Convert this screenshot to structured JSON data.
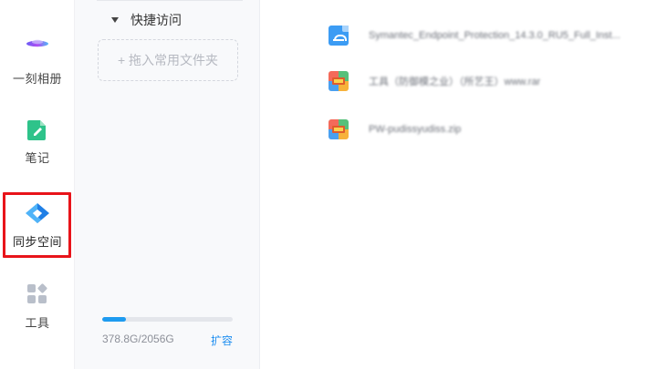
{
  "sidebar": {
    "items": [
      {
        "id": "album",
        "label": "一刻相册",
        "icon": "cloud-photo-icon"
      },
      {
        "id": "notes",
        "label": "笔记",
        "icon": "note-pencil-icon"
      },
      {
        "id": "sync",
        "label": "同步空间",
        "icon": "sync-space-icon",
        "active": true
      },
      {
        "id": "tools",
        "label": "工具",
        "icon": "apps-grid-icon"
      }
    ]
  },
  "quick_access": {
    "title": "快捷访问",
    "drop_hint": "+ 拖入常用文件夹"
  },
  "storage": {
    "usage_text": "378.8G/2056G",
    "used_fraction": 0.184,
    "expand_label": "扩容",
    "bar_color": "#1e9bf0"
  },
  "files": [
    {
      "name": "Symantec_Endpoint_Protection_14.3.0_RU5_Full_Inst...",
      "icon": "document-icon"
    },
    {
      "name": "工具（防御模之业）（所艺王）www.rar",
      "icon": "archive-icon"
    },
    {
      "name": "PW-pudissyudiss.zip",
      "icon": "archive-icon"
    }
  ],
  "highlight_color": "#e8141a"
}
